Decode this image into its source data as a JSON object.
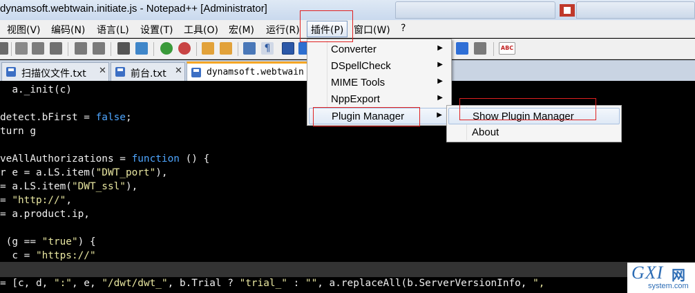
{
  "window": {
    "title": "dynamsoft.webtwain.initiate.js - Notepad++ [Administrator]"
  },
  "menubar": {
    "items": [
      {
        "label": "视图(V)"
      },
      {
        "label": "编码(N)"
      },
      {
        "label": "语言(L)"
      },
      {
        "label": "设置(T)"
      },
      {
        "label": "工具(O)"
      },
      {
        "label": "宏(M)"
      },
      {
        "label": "运行(R)"
      },
      {
        "label": "插件(P)"
      },
      {
        "label": "窗口(W)"
      },
      {
        "label": "?"
      }
    ]
  },
  "tabs": [
    {
      "label": "扫描仪文件.txt",
      "close": "✕"
    },
    {
      "label": "前台.txt",
      "close": "✕"
    },
    {
      "label": "dynamsoft.webtwain"
    }
  ],
  "plugins_menu": {
    "items": [
      {
        "label": "Converter",
        "arrow": "▶"
      },
      {
        "label": "DSpellCheck",
        "arrow": "▶"
      },
      {
        "label": "MIME Tools",
        "arrow": "▶"
      },
      {
        "label": "NppExport",
        "arrow": "▶"
      },
      {
        "label": "Plugin Manager",
        "arrow": "▶"
      }
    ]
  },
  "plugin_manager_submenu": {
    "items": [
      {
        "label": "Show Plugin Manager"
      },
      {
        "label": "About"
      }
    ]
  },
  "toolbar": {
    "spellcheck_label": "ABC"
  },
  "editor": {
    "lines": [
      [
        {
          "t": "  a._init(c)",
          "c": "plain"
        }
      ],
      [
        {
          "t": "",
          "c": "plain"
        }
      ],
      [
        {
          "t": "detect.bFirst = ",
          "c": "plain"
        },
        {
          "t": "false",
          "c": "kw"
        },
        {
          "t": ";",
          "c": "plain"
        }
      ],
      [
        {
          "t": "turn g",
          "c": "plain"
        }
      ],
      [
        {
          "t": "",
          "c": "plain"
        }
      ],
      [
        {
          "t": "veAllAuthorizations = ",
          "c": "plain"
        },
        {
          "t": "function",
          "c": "kw"
        },
        {
          "t": " () {",
          "c": "plain"
        }
      ],
      [
        {
          "t": "r e = a.LS.item(",
          "c": "plain"
        },
        {
          "t": "\"DWT_port\"",
          "c": "str"
        },
        {
          "t": "),",
          "c": "plain"
        }
      ],
      [
        {
          "t": "= a.LS.item(",
          "c": "plain"
        },
        {
          "t": "\"DWT_ssl\"",
          "c": "str"
        },
        {
          "t": "),",
          "c": "plain"
        }
      ],
      [
        {
          "t": "= ",
          "c": "plain"
        },
        {
          "t": "\"http://\"",
          "c": "str"
        },
        {
          "t": ",",
          "c": "plain"
        }
      ],
      [
        {
          "t": "= a.product.ip,",
          "c": "plain"
        }
      ],
      [
        {
          "t": "",
          "c": "plain"
        }
      ],
      [
        {
          "t": " (g == ",
          "c": "plain"
        },
        {
          "t": "\"true\"",
          "c": "str"
        },
        {
          "t": ") {",
          "c": "plain"
        }
      ],
      [
        {
          "t": "  c = ",
          "c": "plain"
        },
        {
          "t": "\"https://\"",
          "c": "str"
        }
      ],
      [
        {
          "t": "",
          "c": "plain"
        }
      ],
      [
        {
          "t": "= [c, d, ",
          "c": "plain"
        },
        {
          "t": "\":\"",
          "c": "str"
        },
        {
          "t": ", e, ",
          "c": "plain"
        },
        {
          "t": "\"/dwt/dwt_\"",
          "c": "str"
        },
        {
          "t": ", b.Trial ? ",
          "c": "plain"
        },
        {
          "t": "\"trial_\"",
          "c": "str"
        },
        {
          "t": " : ",
          "c": "plain"
        },
        {
          "t": "\"\"",
          "c": "str"
        },
        {
          "t": ", a.replaceAll(b.ServerVersionInfo, ",
          "c": "plain"
        },
        {
          "t": "\",",
          "c": "str"
        }
      ]
    ]
  },
  "watermark": {
    "main": "GXI",
    "cn": "网",
    "sub": "system.com"
  },
  "colors": {
    "keyword": "#4ea6ff",
    "string": "#e8e6a0",
    "annotation": "#e02020"
  }
}
